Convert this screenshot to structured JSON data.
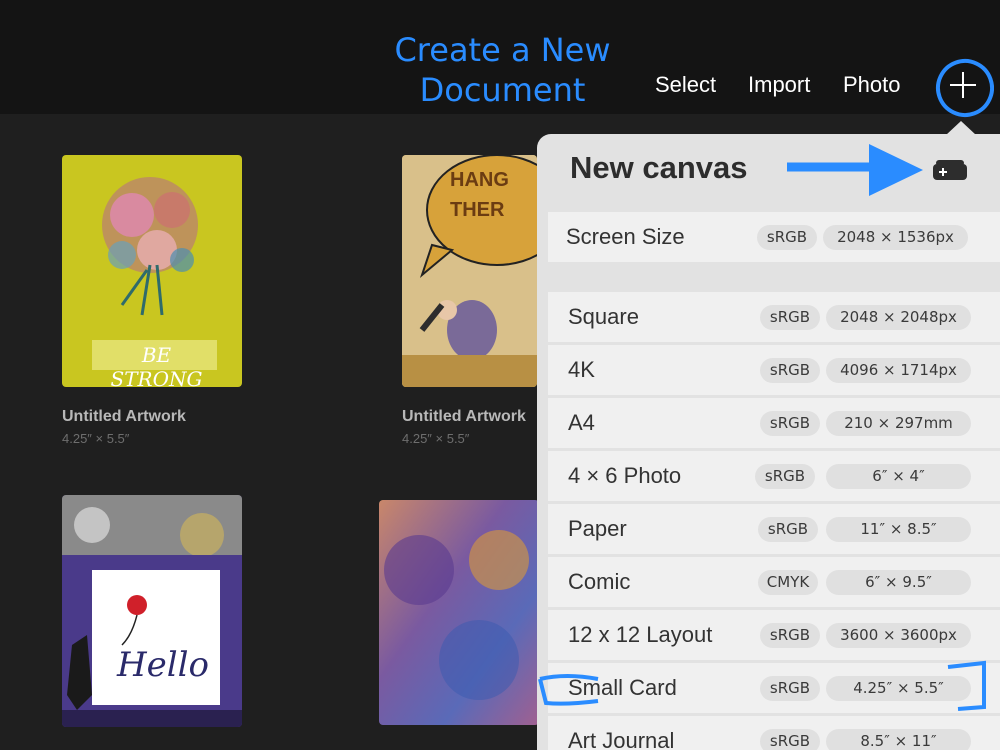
{
  "nav": {
    "select": "Select",
    "import": "Import",
    "photo": "Photo"
  },
  "annotation": {
    "line1": "Create a New",
    "line2": "Document"
  },
  "gallery": {
    "items": [
      {
        "title": "Untitled Artwork",
        "size": "4.25″ × 5.5″",
        "caption": "BE STRONG"
      },
      {
        "title": "Untitled Artwork",
        "size": "4.25″ × 5.5″",
        "caption": "HANG THER"
      },
      {
        "title": "",
        "size": "",
        "caption": "Hello"
      },
      {
        "title": "",
        "size": "",
        "caption": ""
      }
    ]
  },
  "popover": {
    "title": "New canvas",
    "rows": [
      {
        "name": "Screen Size",
        "colorspace": "sRGB",
        "dims": "2048 × 1536px"
      },
      {
        "name": "Square",
        "colorspace": "sRGB",
        "dims": "2048 × 2048px"
      },
      {
        "name": "4K",
        "colorspace": "sRGB",
        "dims": "4096 × 1714px"
      },
      {
        "name": "A4",
        "colorspace": "sRGB",
        "dims": "210 × 297mm"
      },
      {
        "name": "4 × 6 Photo",
        "colorspace": "sRGB",
        "dims": "6″ × 4″"
      },
      {
        "name": "Paper",
        "colorspace": "sRGB",
        "dims": "11″ × 8.5″"
      },
      {
        "name": "Comic",
        "colorspace": "CMYK",
        "dims": "6″ × 9.5″"
      },
      {
        "name": "12 x 12 Layout",
        "colorspace": "sRGB",
        "dims": "3600 × 3600px"
      },
      {
        "name": "Small Card",
        "colorspace": "sRGB",
        "dims": "4.25″ × 5.5″"
      },
      {
        "name": "Art Journal",
        "colorspace": "sRGB",
        "dims": "8.5″ × 11″"
      }
    ]
  },
  "colors": {
    "annotation_blue": "#2a8cff",
    "topbar": "#141414",
    "background": "#1f1f1f",
    "popover": "#e2e2e2"
  },
  "icons": {
    "add": "plus-icon",
    "custom_canvas": "add-custom-canvas-icon"
  }
}
